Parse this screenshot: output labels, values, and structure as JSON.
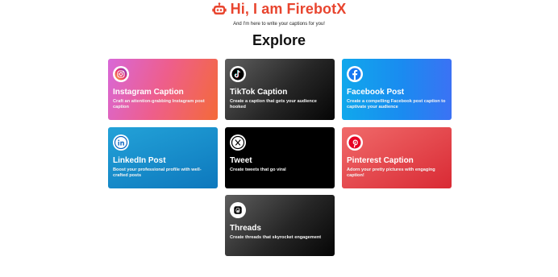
{
  "header": {
    "title": "Hi, I am FirebotX",
    "subtitle": "And I'm here to write your captions for you!",
    "icon": "robot-icon",
    "accent": "#e8452f"
  },
  "explore": {
    "heading": "Explore"
  },
  "cards": [
    {
      "title": "Instagram Caption",
      "description": "Craft an attention-grabbing Instagram post caption",
      "icon": "instagram-icon",
      "color": "#ee5e8c"
    },
    {
      "title": "TikTok Caption",
      "description": "Create a caption that gets your audience hooked",
      "icon": "tiktok-icon",
      "color": "#262626"
    },
    {
      "title": "Facebook Post",
      "description": "Create a compelling Facebook post caption to captivate your audience",
      "icon": "facebook-icon",
      "color": "#1a8bf0"
    },
    {
      "title": "LinkedIn Post",
      "description": "Boost your professional profile with well-crafted posts",
      "icon": "linkedin-icon",
      "color": "#0d78bd"
    },
    {
      "title": "Tweet",
      "description": "Create tweets that go viral",
      "icon": "x-icon",
      "color": "#000000"
    },
    {
      "title": "Pinterest Caption",
      "description": "Adorn your pretty pictures with engaging caption!",
      "icon": "pinterest-icon",
      "color": "#d92a34"
    },
    {
      "title": "Threads",
      "description": "Create threads that skyrocket engagement",
      "icon": "threads-icon",
      "color": "#262626"
    }
  ]
}
